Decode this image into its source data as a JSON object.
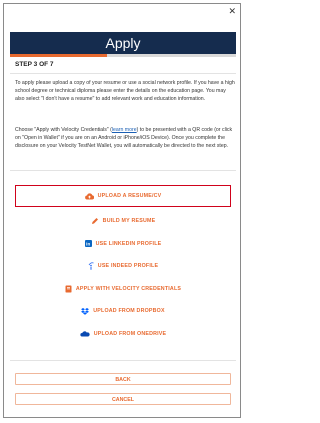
{
  "header": {
    "title": "Apply"
  },
  "progress": {
    "fraction": 0.43
  },
  "step": {
    "label": "STEP 3 OF 7"
  },
  "intro": {
    "paragraph1": "To apply please upload a copy of your resume or use a social network profile. If you have a high school degree or technical diploma please enter the details on the education page. You may also select \"I don't have a resume\" to add relevant work and education information.",
    "paragraph2_before": "Choose \"Apply with Velocity Credentials\" (",
    "learn_more": "learn more",
    "paragraph2_after": ") to be presented with a QR code (or click on \"Open in Wallet\" if you are on an Android or iPhone/iOS Device). Once you complete the disclosure on your Velocity TestNet Wallet, you will automatically be directed to the next step."
  },
  "options": [
    {
      "label": "UPLOAD A RESUME/CV",
      "icon": "cloud-upload-icon"
    },
    {
      "label": "BUILD MY RESUME",
      "icon": "pencil-icon"
    },
    {
      "label": "USE LINKEDIN PROFILE",
      "icon": "linkedin-icon"
    },
    {
      "label": "USE INDEED PROFILE",
      "icon": "indeed-icon"
    },
    {
      "label": "APPLY WITH VELOCITY CREDENTIALS",
      "icon": "velocity-icon"
    },
    {
      "label": "UPLOAD FROM DROPBOX",
      "icon": "dropbox-icon"
    },
    {
      "label": "UPLOAD FROM ONEDRIVE",
      "icon": "onedrive-icon"
    }
  ],
  "footer": {
    "back_label": "BACK",
    "cancel_label": "CANCEL"
  },
  "colors": {
    "header_bg": "#152c4e",
    "accent": "#e86a30",
    "highlight": "#d0021b",
    "linkedin": "#0a66c2",
    "indeed": "#2164f3",
    "dropbox": "#0061fe",
    "onedrive": "#094ab2"
  }
}
